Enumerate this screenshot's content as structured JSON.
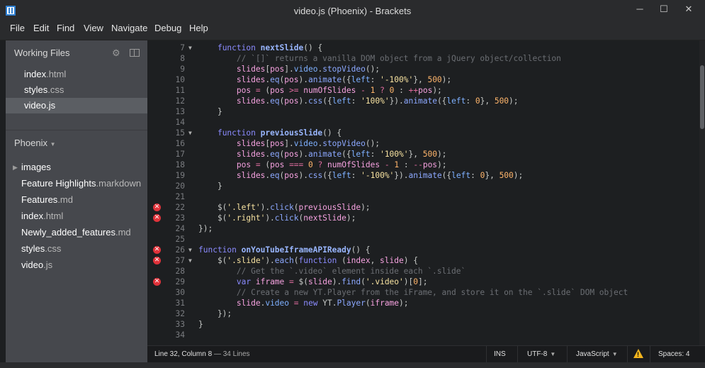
{
  "window": {
    "title": "video.js (Phoenix) - Brackets",
    "minimize": "─",
    "maximize": "☐",
    "close": "✕"
  },
  "menu": [
    "File",
    "Edit",
    "Find",
    "View",
    "Navigate",
    "Debug",
    "Help"
  ],
  "working_files": {
    "header": "Working Files",
    "files": [
      {
        "name": "index",
        "ext": ".html",
        "active": false
      },
      {
        "name": "styles",
        "ext": ".css",
        "active": false
      },
      {
        "name": "video",
        "ext": ".js",
        "active": true
      }
    ]
  },
  "project": {
    "name": "Phoenix",
    "items": [
      {
        "name": "images",
        "ext": "",
        "folder": true
      },
      {
        "name": "Feature Highlights",
        "ext": ".markdown",
        "folder": false
      },
      {
        "name": "Features",
        "ext": ".md",
        "folder": false
      },
      {
        "name": "index",
        "ext": ".html",
        "folder": false
      },
      {
        "name": "Newly_added_features",
        "ext": ".md",
        "folder": false
      },
      {
        "name": "styles",
        "ext": ".css",
        "folder": false
      },
      {
        "name": "video",
        "ext": ".js",
        "folder": false
      }
    ]
  },
  "editor": {
    "lines": [
      {
        "n": "7",
        "fold": true,
        "err": false
      },
      {
        "n": "8",
        "fold": false,
        "err": false
      },
      {
        "n": "9",
        "fold": false,
        "err": false
      },
      {
        "n": "10",
        "fold": false,
        "err": false
      },
      {
        "n": "11",
        "fold": false,
        "err": false
      },
      {
        "n": "12",
        "fold": false,
        "err": false
      },
      {
        "n": "13",
        "fold": false,
        "err": false
      },
      {
        "n": "14",
        "fold": false,
        "err": false
      },
      {
        "n": "15",
        "fold": true,
        "err": false
      },
      {
        "n": "16",
        "fold": false,
        "err": false
      },
      {
        "n": "17",
        "fold": false,
        "err": false
      },
      {
        "n": "18",
        "fold": false,
        "err": false
      },
      {
        "n": "19",
        "fold": false,
        "err": false
      },
      {
        "n": "20",
        "fold": false,
        "err": false
      },
      {
        "n": "21",
        "fold": false,
        "err": false
      },
      {
        "n": "22",
        "fold": false,
        "err": true
      },
      {
        "n": "23",
        "fold": false,
        "err": true
      },
      {
        "n": "24",
        "fold": false,
        "err": false
      },
      {
        "n": "25",
        "fold": false,
        "err": false
      },
      {
        "n": "26",
        "fold": true,
        "err": true
      },
      {
        "n": "27",
        "fold": true,
        "err": true
      },
      {
        "n": "28",
        "fold": false,
        "err": false
      },
      {
        "n": "29",
        "fold": false,
        "err": true
      },
      {
        "n": "30",
        "fold": false,
        "err": false
      },
      {
        "n": "31",
        "fold": false,
        "err": false
      },
      {
        "n": "32",
        "fold": false,
        "err": false
      },
      {
        "n": "33",
        "fold": false,
        "err": false
      },
      {
        "n": "34",
        "fold": false,
        "err": false
      }
    ],
    "code": [
      [
        [
          "    ",
          ""
        ],
        [
          "function",
          "kw"
        ],
        [
          " ",
          ""
        ],
        [
          "nextSlide",
          "fnname"
        ],
        [
          "() {",
          ""
        ]
      ],
      [
        [
          "        ",
          ""
        ],
        [
          "// `[]` returns a vanilla DOM object from a jQuery object/collection",
          "cmt"
        ]
      ],
      [
        [
          "        ",
          ""
        ],
        [
          "slides",
          "var"
        ],
        [
          "[",
          ""
        ],
        [
          "pos",
          "var"
        ],
        [
          "].",
          ""
        ],
        [
          "video",
          "prop"
        ],
        [
          ".",
          ""
        ],
        [
          "stopVideo",
          "fn"
        ],
        [
          "();",
          ""
        ]
      ],
      [
        [
          "        ",
          ""
        ],
        [
          "slides",
          "var"
        ],
        [
          ".",
          ""
        ],
        [
          "eq",
          "fn"
        ],
        [
          "(",
          ""
        ],
        [
          "pos",
          "var"
        ],
        [
          ").",
          ""
        ],
        [
          "animate",
          "fn"
        ],
        [
          "({",
          ""
        ],
        [
          "left",
          "prop"
        ],
        [
          ": ",
          ""
        ],
        [
          "'-100%'",
          "str"
        ],
        [
          "}, ",
          ""
        ],
        [
          "500",
          "num"
        ],
        [
          ");",
          ""
        ]
      ],
      [
        [
          "        ",
          ""
        ],
        [
          "pos",
          "var"
        ],
        [
          " ",
          ""
        ],
        [
          "=",
          "op"
        ],
        [
          " (",
          ""
        ],
        [
          "pos",
          "var"
        ],
        [
          " ",
          ""
        ],
        [
          ">=",
          "op"
        ],
        [
          " ",
          ""
        ],
        [
          "numOfSlides",
          "var"
        ],
        [
          " ",
          ""
        ],
        [
          "-",
          "op"
        ],
        [
          " ",
          ""
        ],
        [
          "1",
          "num"
        ],
        [
          " ",
          ""
        ],
        [
          "?",
          "op"
        ],
        [
          " ",
          ""
        ],
        [
          "0",
          "num"
        ],
        [
          " : ",
          ""
        ],
        [
          "++",
          "op"
        ],
        [
          "pos",
          "var"
        ],
        [
          ");",
          ""
        ]
      ],
      [
        [
          "        ",
          ""
        ],
        [
          "slides",
          "var"
        ],
        [
          ".",
          ""
        ],
        [
          "eq",
          "fn"
        ],
        [
          "(",
          ""
        ],
        [
          "pos",
          "var"
        ],
        [
          ").",
          ""
        ],
        [
          "css",
          "fn"
        ],
        [
          "({",
          ""
        ],
        [
          "left",
          "prop"
        ],
        [
          ": ",
          ""
        ],
        [
          "'100%'",
          "str"
        ],
        [
          "}).",
          ""
        ],
        [
          "animate",
          "fn"
        ],
        [
          "({",
          ""
        ],
        [
          "left",
          "prop"
        ],
        [
          ": ",
          ""
        ],
        [
          "0",
          "num"
        ],
        [
          "}, ",
          ""
        ],
        [
          "500",
          "num"
        ],
        [
          ");",
          ""
        ]
      ],
      [
        [
          "    }",
          ""
        ]
      ],
      [
        [
          "",
          ""
        ]
      ],
      [
        [
          "    ",
          ""
        ],
        [
          "function",
          "kw"
        ],
        [
          " ",
          ""
        ],
        [
          "previousSlide",
          "fnname"
        ],
        [
          "() {",
          ""
        ]
      ],
      [
        [
          "        ",
          ""
        ],
        [
          "slides",
          "var"
        ],
        [
          "[",
          ""
        ],
        [
          "pos",
          "var"
        ],
        [
          "].",
          ""
        ],
        [
          "video",
          "prop"
        ],
        [
          ".",
          ""
        ],
        [
          "stopVideo",
          "fn"
        ],
        [
          "();",
          ""
        ]
      ],
      [
        [
          "        ",
          ""
        ],
        [
          "slides",
          "var"
        ],
        [
          ".",
          ""
        ],
        [
          "eq",
          "fn"
        ],
        [
          "(",
          ""
        ],
        [
          "pos",
          "var"
        ],
        [
          ").",
          ""
        ],
        [
          "animate",
          "fn"
        ],
        [
          "({",
          ""
        ],
        [
          "left",
          "prop"
        ],
        [
          ": ",
          ""
        ],
        [
          "'100%'",
          "str"
        ],
        [
          "}, ",
          ""
        ],
        [
          "500",
          "num"
        ],
        [
          ");",
          ""
        ]
      ],
      [
        [
          "        ",
          ""
        ],
        [
          "pos",
          "var"
        ],
        [
          " ",
          ""
        ],
        [
          "=",
          "op"
        ],
        [
          " (",
          ""
        ],
        [
          "pos",
          "var"
        ],
        [
          " ",
          ""
        ],
        [
          "===",
          "op"
        ],
        [
          " ",
          ""
        ],
        [
          "0",
          "num"
        ],
        [
          " ",
          ""
        ],
        [
          "?",
          "op"
        ],
        [
          " ",
          ""
        ],
        [
          "numOfSlides",
          "var"
        ],
        [
          " ",
          ""
        ],
        [
          "-",
          "op"
        ],
        [
          " ",
          ""
        ],
        [
          "1",
          "num"
        ],
        [
          " : ",
          ""
        ],
        [
          "--",
          "op"
        ],
        [
          "pos",
          "var"
        ],
        [
          ");",
          ""
        ]
      ],
      [
        [
          "        ",
          ""
        ],
        [
          "slides",
          "var"
        ],
        [
          ".",
          ""
        ],
        [
          "eq",
          "fn"
        ],
        [
          "(",
          ""
        ],
        [
          "pos",
          "var"
        ],
        [
          ").",
          ""
        ],
        [
          "css",
          "fn"
        ],
        [
          "({",
          ""
        ],
        [
          "left",
          "prop"
        ],
        [
          ": ",
          ""
        ],
        [
          "'-100%'",
          "str"
        ],
        [
          "}).",
          ""
        ],
        [
          "animate",
          "fn"
        ],
        [
          "({",
          ""
        ],
        [
          "left",
          "prop"
        ],
        [
          ": ",
          ""
        ],
        [
          "0",
          "num"
        ],
        [
          "}, ",
          ""
        ],
        [
          "500",
          "num"
        ],
        [
          ");",
          ""
        ]
      ],
      [
        [
          "    }",
          ""
        ]
      ],
      [
        [
          "",
          ""
        ]
      ],
      [
        [
          "    $(",
          ""
        ],
        [
          "'.left'",
          "str"
        ],
        [
          ").",
          ""
        ],
        [
          "click",
          "fn"
        ],
        [
          "(",
          ""
        ],
        [
          "previousSlide",
          "var"
        ],
        [
          ");",
          ""
        ]
      ],
      [
        [
          "    $(",
          ""
        ],
        [
          "'.right'",
          "str"
        ],
        [
          ").",
          ""
        ],
        [
          "click",
          "fn"
        ],
        [
          "(",
          ""
        ],
        [
          "nextSlide",
          "var"
        ],
        [
          ");",
          ""
        ]
      ],
      [
        [
          "});",
          ""
        ]
      ],
      [
        [
          "",
          ""
        ]
      ],
      [
        [
          "function",
          "kw"
        ],
        [
          " ",
          ""
        ],
        [
          "onYouTubeIframeAPIReady",
          "fnname"
        ],
        [
          "() {",
          ""
        ]
      ],
      [
        [
          "    $(",
          ""
        ],
        [
          "'.slide'",
          "str"
        ],
        [
          ").",
          ""
        ],
        [
          "each",
          "fn"
        ],
        [
          "(",
          ""
        ],
        [
          "function",
          "kw"
        ],
        [
          " (",
          ""
        ],
        [
          "index",
          "var"
        ],
        [
          ", ",
          ""
        ],
        [
          "slide",
          "var"
        ],
        [
          ") {",
          ""
        ]
      ],
      [
        [
          "        ",
          ""
        ],
        [
          "// Get the `.video` element inside each `.slide`",
          "cmt"
        ]
      ],
      [
        [
          "        ",
          ""
        ],
        [
          "var",
          "kw"
        ],
        [
          " ",
          ""
        ],
        [
          "iframe",
          "var"
        ],
        [
          " ",
          ""
        ],
        [
          "=",
          "op"
        ],
        [
          " $(",
          ""
        ],
        [
          "slide",
          "var"
        ],
        [
          ").",
          ""
        ],
        [
          "find",
          "fn"
        ],
        [
          "(",
          ""
        ],
        [
          "'.video'",
          "str"
        ],
        [
          ")[",
          ""
        ],
        [
          "0",
          "num"
        ],
        [
          "];",
          ""
        ]
      ],
      [
        [
          "        ",
          ""
        ],
        [
          "// Create a new YT.Player from the iFrame, and store it on the `.slide` DOM object",
          "cmt"
        ]
      ],
      [
        [
          "        ",
          ""
        ],
        [
          "slide",
          "var"
        ],
        [
          ".",
          ""
        ],
        [
          "video",
          "prop"
        ],
        [
          " ",
          ""
        ],
        [
          "=",
          "op"
        ],
        [
          " ",
          ""
        ],
        [
          "new",
          "kw"
        ],
        [
          " YT.",
          ""
        ],
        [
          "Player",
          "fn"
        ],
        [
          "(",
          ""
        ],
        [
          "iframe",
          "var"
        ],
        [
          ");",
          ""
        ]
      ],
      [
        [
          "    });",
          ""
        ]
      ],
      [
        [
          "}",
          ""
        ]
      ],
      [
        [
          "",
          ""
        ]
      ]
    ]
  },
  "status": {
    "position": "Line 32, Column 8",
    "lines_info": " — 34 Lines",
    "mode": "INS",
    "encoding": "UTF-8",
    "language": "JavaScript",
    "indent": "Spaces: 4",
    "warning_icon": "warning-icon"
  }
}
